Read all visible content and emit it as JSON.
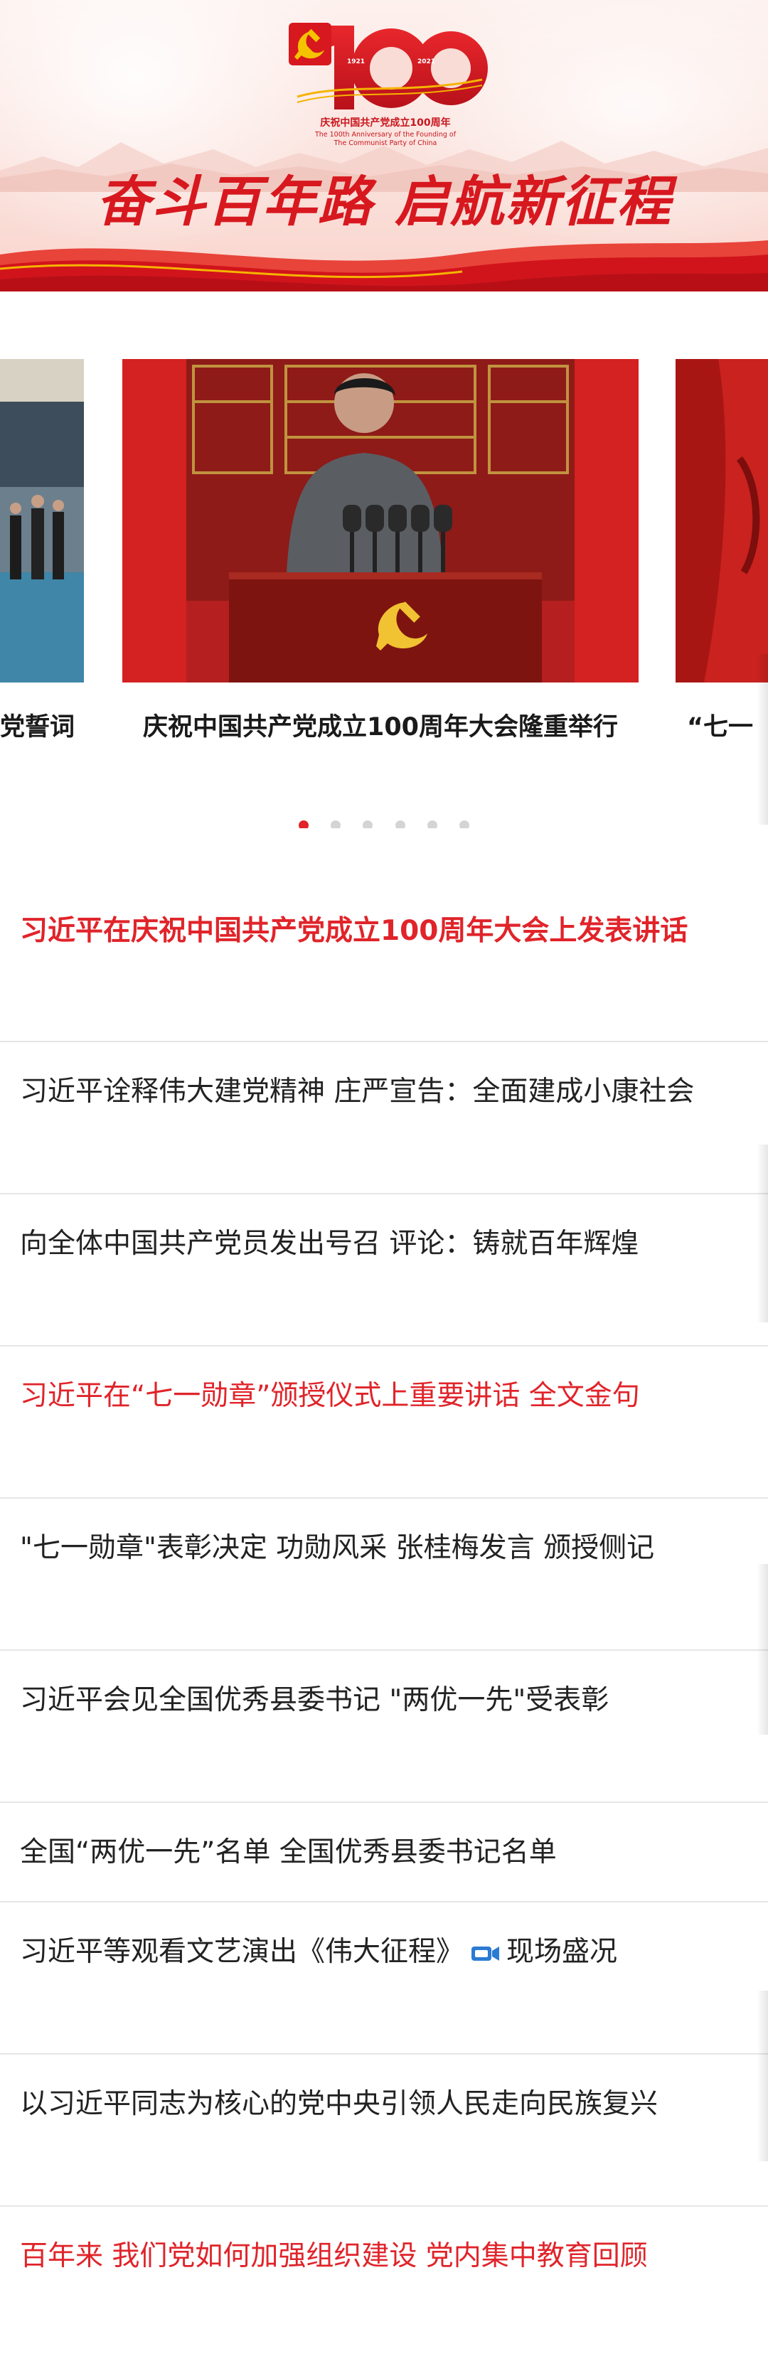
{
  "banner": {
    "logo_caption": "庆祝中国共产党成立100周年",
    "logo_en_line1": "The 100th Anniversary of the Founding of",
    "logo_en_line2": "The Communist Party of China",
    "year_start": "1921",
    "year_end": "2021",
    "slogan_part1": "奋斗百年路",
    "slogan_part2": "启航新征程"
  },
  "carousel": {
    "slides": [
      {
        "caption": "党誓词"
      },
      {
        "caption": "庆祝中国共产党成立100周年大会隆重举行"
      },
      {
        "caption": "“七一"
      }
    ],
    "dot_count": 6,
    "active_dot": 1
  },
  "news": [
    {
      "text": "习近平在庆祝中国共产党成立100周年大会上发表讲话",
      "color": "red",
      "bold": true
    },
    {
      "text": "习近平诠释伟大建党精神 庄严宣告：全面建成小康社会",
      "color": "black"
    },
    {
      "text": "向全体中国共产党员发出号召 评论：铸就百年辉煌",
      "color": "black"
    },
    {
      "text": "习近平在“七一勋章”颁授仪式上重要讲话 全文金句",
      "color": "red"
    },
    {
      "text": "\"七一勋章\"表彰决定 功勋风采 张桂梅发言 颁授侧记",
      "color": "black"
    },
    {
      "text": "习近平会见全国优秀县委书记 \"两优一先\"受表彰",
      "color": "black"
    },
    {
      "text": "全国“两优一先”名单   全国优秀县委书记名单",
      "color": "black"
    },
    {
      "text_before": "习近平等观看文艺演出《伟大征程》",
      "icon": "video-icon",
      "text_after": "现场盛况",
      "color": "black"
    },
    {
      "text": "以习近平同志为核心的党中央引领人民走向民族复兴",
      "color": "black"
    },
    {
      "text": "百年来 我们党如何加强组织建设 党内集中教育回顾",
      "color": "red"
    }
  ],
  "colors": {
    "accent_red": "#e0242a",
    "banner_red": "#d7181f",
    "text_dark": "#222222",
    "divider": "#e6e6e6"
  }
}
